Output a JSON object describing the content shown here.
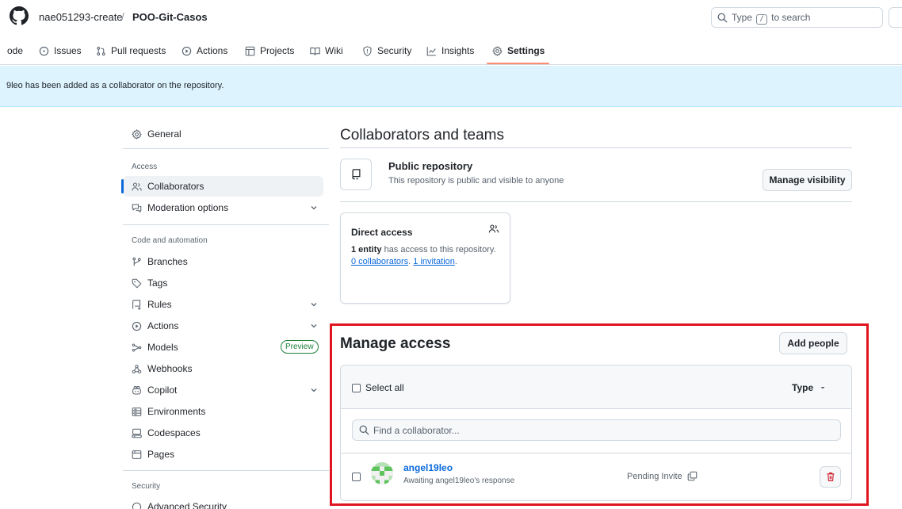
{
  "header": {
    "owner": "nae051293-create",
    "separator": "/",
    "repo": "POO-Git-Casos",
    "search_prefix": "Type",
    "search_key": "/",
    "search_suffix": "to search"
  },
  "nav": {
    "code": "ode",
    "issues": "Issues",
    "pull_requests": "Pull requests",
    "actions": "Actions",
    "projects": "Projects",
    "wiki": "Wiki",
    "security": "Security",
    "insights": "Insights",
    "settings": "Settings"
  },
  "flash": {
    "message": "9leo has been added as a collaborator on the repository."
  },
  "sidebar": {
    "general": "General",
    "access_heading": "Access",
    "collaborators": "Collaborators",
    "moderation": "Moderation options",
    "code_heading": "Code and automation",
    "branches": "Branches",
    "tags": "Tags",
    "rules": "Rules",
    "actions": "Actions",
    "models": "Models",
    "preview_badge": "Preview",
    "webhooks": "Webhooks",
    "copilot": "Copilot",
    "environments": "Environments",
    "codespaces": "Codespaces",
    "pages": "Pages",
    "security_heading": "Security",
    "advanced_security": "Advanced Security"
  },
  "main": {
    "title": "Collaborators and teams",
    "public_title": "Public repository",
    "public_desc": "This repository is public and visible to anyone",
    "manage_visibility": "Manage visibility",
    "direct_access": {
      "title": "Direct access",
      "entity": "1 entity",
      "text1": " has access to this repository. ",
      "collab_link": "0 collaborators",
      "text2": ". ",
      "invite_link": "1 invitation",
      "text3": "."
    },
    "manage_access": "Manage access",
    "add_people": "Add people",
    "select_all": "Select all",
    "type_filter": "Type",
    "find_placeholder": "Find a collaborator...",
    "collaborator": {
      "username": "angel19leo",
      "status": "Awaiting angel19leo's response",
      "pending": "Pending Invite"
    }
  },
  "colors": {
    "accent": "#0969da",
    "highlight": "#e0141e",
    "danger": "#cf222e",
    "flash_bg": "#ddf4ff"
  }
}
